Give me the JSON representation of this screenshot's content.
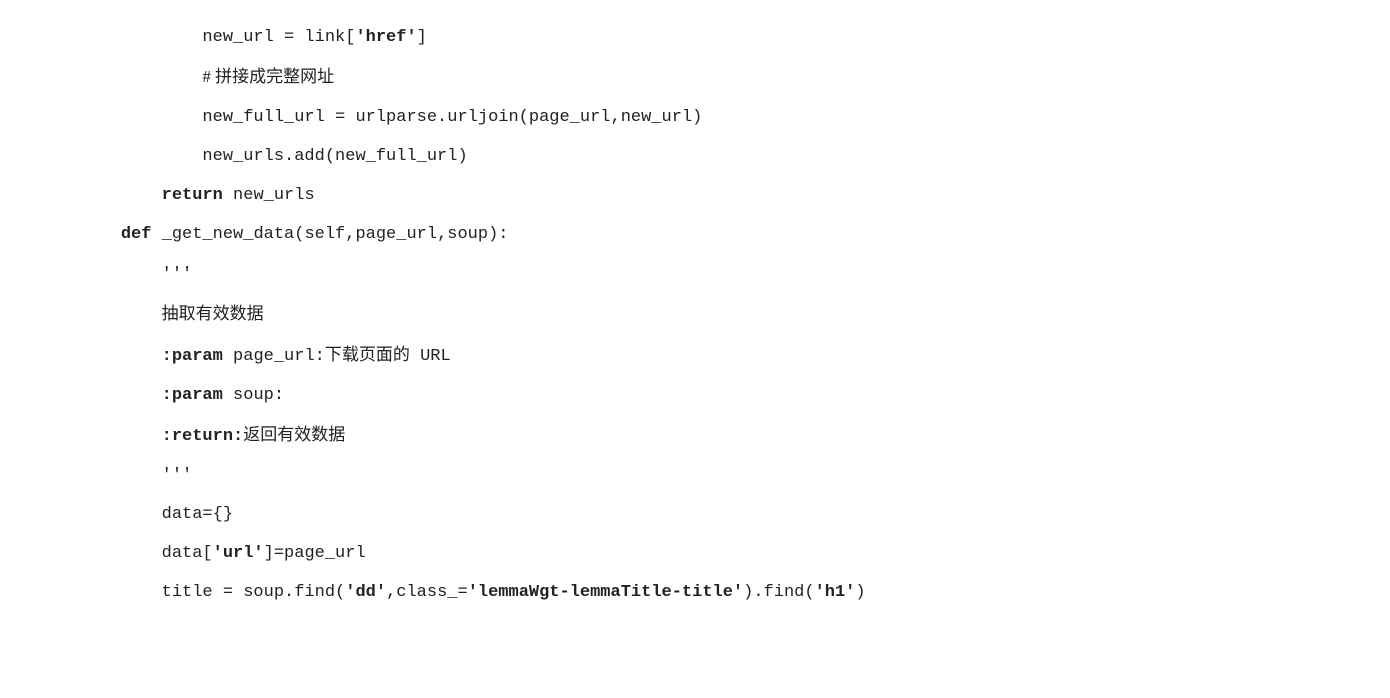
{
  "lines": {
    "l1_p1": "            new_url = link[",
    "l1_str": "'href'",
    "l1_p2": "]",
    "l2_p1": "            ",
    "l2_comment": "# 拼接成完整网址",
    "l3": "            new_full_url = urlparse.urljoin(page_url,new_url)",
    "l4": "            new_urls.add(new_full_url)",
    "l5_p1": "        ",
    "l5_kw": "return",
    "l5_p2": " new_urls",
    "l6_p1": "    ",
    "l6_kw": "def",
    "l6_p2": " _get_new_data(self,page_url,soup):",
    "l7": "        '''",
    "l8_p1": "        ",
    "l8_txt": "抽取有效数据",
    "l9_p1": "        ",
    "l9_kw": ":param",
    "l9_p2": " page_url:",
    "l9_txt": "下载页面的",
    "l9_p3": " URL",
    "l10_p1": "        ",
    "l10_kw": ":param",
    "l10_p2": " soup:",
    "l11_p1": "        ",
    "l11_kw": ":return:",
    "l11_txt": "返回有效数据",
    "l12": "        '''",
    "l13": "        data={}",
    "l14_p1": "        data[",
    "l14_str": "'url'",
    "l14_p2": "]=page_url",
    "l15_p1": "        title = soup.find(",
    "l15_s1": "'dd'",
    "l15_p2": ",class_=",
    "l15_s2": "'lemmaWgt-lemmaTitle-title'",
    "l15_p3": ").find(",
    "l15_s3": "'h1'",
    "l15_p4": ")"
  }
}
